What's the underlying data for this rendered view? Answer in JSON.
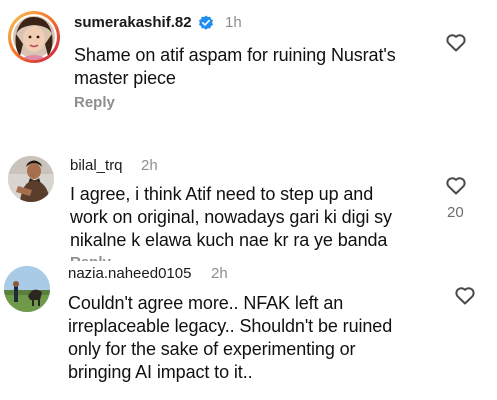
{
  "comments": [
    {
      "username": "sumerakashif.82",
      "verified": true,
      "time": "1h",
      "lines": [
        "Shame on atif aspam for ruining Nusrat's",
        "master piece"
      ],
      "reply_label": "Reply",
      "icon": "heart-outline-icon"
    },
    {
      "username": "bilal_trq",
      "time": "2h",
      "lines": [
        "I agree, i think Atif need to step up and",
        "work on original, nowadays gari ki digi sy",
        "nikalne k elawa kuch nae kr ra ye banda"
      ],
      "reply_label": "Reply",
      "likes": "20",
      "icon": "heart-outline-icon"
    },
    {
      "username": "nazia.naheed0105",
      "time": "2h",
      "lines": [
        "Couldn't agree more.. NFAK left an",
        "irreplaceable legacy.. Shouldn't be ruined",
        "only for the sake of experimenting or",
        "bringing AI impact to it.."
      ],
      "icon": "heart-outline-icon"
    }
  ],
  "colors": {
    "verified": "#1f8ef1",
    "muted": "#8e8e8e",
    "text": "#111111"
  }
}
